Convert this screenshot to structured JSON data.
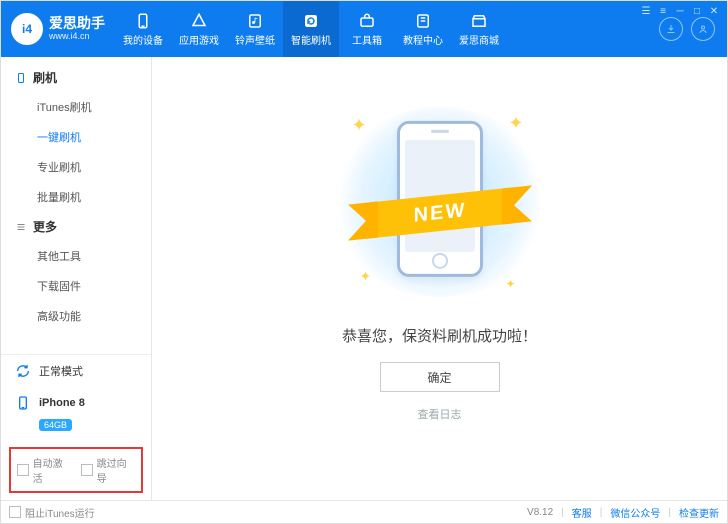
{
  "app": {
    "name": "爱思助手",
    "url": "www.i4.cn",
    "logo_text": "i4"
  },
  "header": {
    "navs": [
      {
        "label": "我的设备",
        "icon": "phone-icon"
      },
      {
        "label": "应用游戏",
        "icon": "apps-icon"
      },
      {
        "label": "铃声壁纸",
        "icon": "music-icon"
      },
      {
        "label": "智能刷机",
        "icon": "refresh-icon",
        "active": true
      },
      {
        "label": "工具箱",
        "icon": "toolbox-icon"
      },
      {
        "label": "教程中心",
        "icon": "book-icon"
      },
      {
        "label": "爱思商城",
        "icon": "store-icon"
      }
    ]
  },
  "sidebar": {
    "section1": {
      "title": "刷机",
      "items": [
        {
          "label": "iTunes刷机"
        },
        {
          "label": "一键刷机",
          "active": true
        },
        {
          "label": "专业刷机"
        },
        {
          "label": "批量刷机"
        }
      ]
    },
    "section2": {
      "title": "更多",
      "items": [
        {
          "label": "其他工具"
        },
        {
          "label": "下载固件"
        },
        {
          "label": "高级功能"
        }
      ]
    },
    "mode": "正常模式",
    "device": {
      "name": "iPhone 8",
      "badge": "64GB"
    },
    "opts": {
      "auto_activate": "自动激活",
      "skip_guide": "跳过向导"
    }
  },
  "main": {
    "banner_text": "NEW",
    "message": "恭喜您，保资料刷机成功啦！",
    "ok_label": "确定",
    "log_label": "查看日志"
  },
  "statusbar": {
    "left_label": "阻止iTunes运行",
    "version": "V8.12",
    "links": {
      "service": "客服",
      "wechat": "微信公众号",
      "update": "检查更新"
    }
  }
}
